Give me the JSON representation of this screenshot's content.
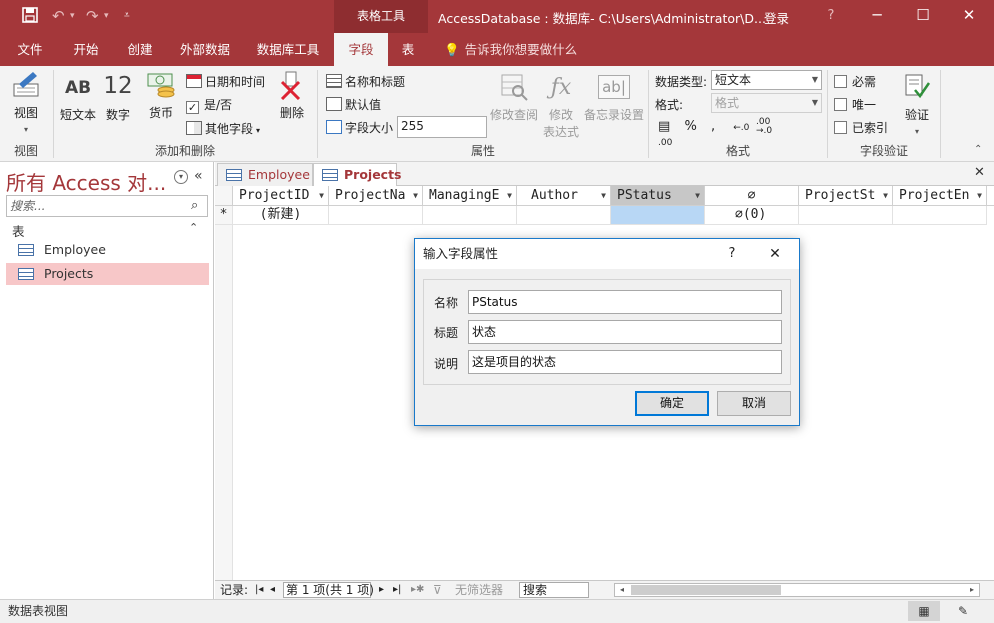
{
  "titlebar": {
    "context_tab": "表格工具",
    "doc_title": "AccessDatabase : 数据库- C:\\Users\\Administrator\\D...",
    "login": "登录",
    "help": "?",
    "minimize": "─",
    "restore": "☐",
    "close": "✕"
  },
  "tabs": [
    "文件",
    "开始",
    "创建",
    "外部数据",
    "数据库工具",
    "字段",
    "表"
  ],
  "active_tab": "字段",
  "tellme": "告诉我你想要做什么",
  "ribbon": {
    "view": {
      "label": "视图",
      "group": "视图"
    },
    "add_delete": {
      "group": "添加和删除",
      "short_text": {
        "icon": "AB",
        "label": "短文本"
      },
      "number": {
        "icon": "12",
        "label": "数字"
      },
      "currency": {
        "label": "货币"
      },
      "datetime": "日期和时间",
      "yesno": "是/否",
      "more_fields": "其他字段",
      "delete": "删除"
    },
    "properties": {
      "group": "属性",
      "name_caption": "名称和标题",
      "default_value": "默认值",
      "field_size_label": "字段大小",
      "field_size_value": "255",
      "modify_lookup": "修改查阅",
      "modify_expression_1": "修改",
      "modify_expression_2": "表达式",
      "memo_settings": "备忘录设置"
    },
    "formatting": {
      "group": "格式",
      "data_type_label": "数据类型:",
      "data_type_value": "短文本",
      "format_label": "格式:",
      "format_value": "格式"
    },
    "validation": {
      "group": "字段验证",
      "required": "必需",
      "unique": "唯一",
      "indexed": "已索引",
      "validate": "验证"
    }
  },
  "nav": {
    "title": "所有 Access 对...",
    "search_placeholder": "搜索...",
    "section": "表",
    "items": [
      "Employee",
      "Projects"
    ]
  },
  "doc_tabs": [
    "Employee",
    "Projects"
  ],
  "sheet": {
    "headers": [
      "ProjectID",
      "ProjectNa",
      "ManagingE",
      "Author",
      "PStatus",
      "",
      "ProjectSt",
      "ProjectEn"
    ],
    "new_row_marker": "*",
    "new_row_text": "(新建)",
    "attachment_count": "(0)"
  },
  "recnav": {
    "label": "记录:",
    "position": "第 1 项(共 1 项)",
    "filter": "无筛选器",
    "search": "搜索"
  },
  "status": {
    "text": "数据表视图"
  },
  "dialog": {
    "title": "输入字段属性",
    "help": "?",
    "close": "✕",
    "name_label": "名称",
    "name_value": "PStatus",
    "caption_label": "标题",
    "caption_value": "状态",
    "desc_label": "说明",
    "desc_value": "这是项目的状态",
    "ok": "确定",
    "cancel": "取消"
  },
  "colors": {
    "accent": "#a4373a",
    "selected_nav": "#f7c7c8",
    "dialog_border": "#1979ca"
  }
}
